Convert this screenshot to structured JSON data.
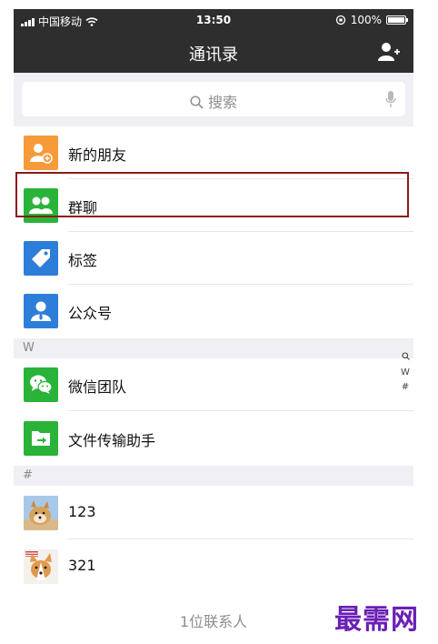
{
  "status": {
    "carrier": "中国移动",
    "time": "13:50",
    "battery": "100%",
    "battery_level": 1.0
  },
  "nav": {
    "title": "通讯录",
    "add_icon": "add-contact-icon"
  },
  "search": {
    "placeholder": "搜索"
  },
  "rows_top": [
    {
      "label": "新的朋友",
      "icon": "new-friend-icon",
      "color": "#f79a3a"
    },
    {
      "label": "群聊",
      "icon": "group-chat-icon",
      "color": "#29b338"
    },
    {
      "label": "标签",
      "icon": "tag-icon",
      "color": "#2d7ed8"
    },
    {
      "label": "公众号",
      "icon": "official-account-icon",
      "color": "#2d7ed8"
    }
  ],
  "section_w": "W",
  "rows_w": [
    {
      "label": "微信团队",
      "icon": "wechat-icon",
      "color": "#29b338"
    },
    {
      "label": "文件传输助手",
      "icon": "file-transfer-icon",
      "color": "#29b338"
    }
  ],
  "section_hash": "#",
  "rows_hash": [
    {
      "label": "123",
      "icon": "dog-avatar"
    },
    {
      "label": "321",
      "icon": "corgi-avatar"
    }
  ],
  "index_bar": [
    "W",
    "#"
  ],
  "footer": "1位联系人",
  "watermark": "最需网",
  "highlight_color": "#8b1a1a"
}
